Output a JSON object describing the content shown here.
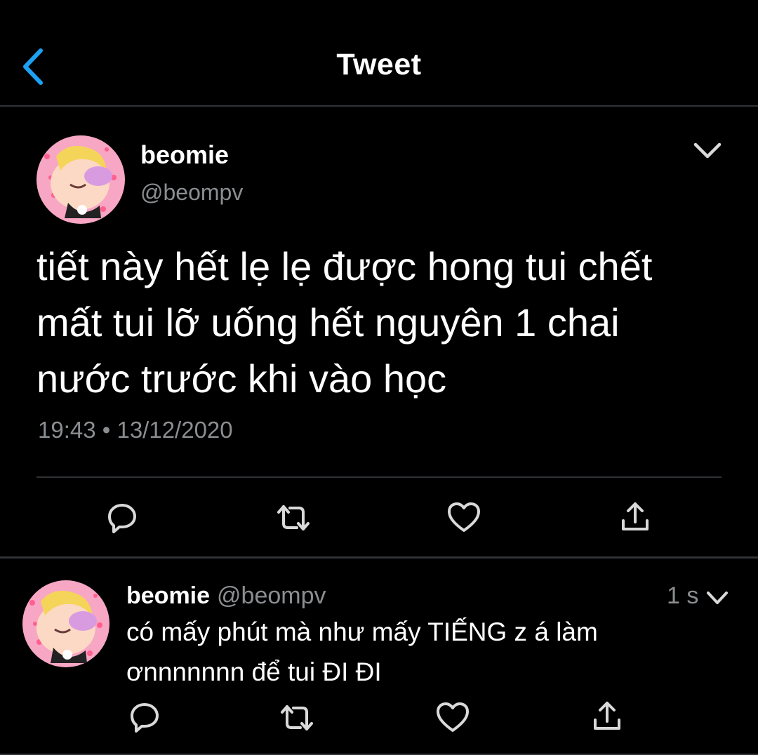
{
  "header": {
    "title": "Tweet",
    "back_icon": "chevron-left-icon",
    "accent": "#1da1f2"
  },
  "tweet": {
    "display_name": "beomie",
    "handle": "@beompv",
    "text_lines": [
      "tiết này hết lẹ lẹ được hong tui chết",
      "mất tui lỡ uống hết nguyên 1 chai",
      "nước trước khi vào học"
    ],
    "timestamp": "19:43 • 13/12/2020",
    "actions": [
      "reply-icon",
      "retweet-icon",
      "like-icon",
      "share-icon"
    ]
  },
  "reply": {
    "display_name": "beomie",
    "handle": "@beompv",
    "time": "1 s",
    "text_lines": [
      "có mấy phút mà như mấy TIẾNG z á làm",
      "ơnnnnnnn để tui ĐI ĐI"
    ],
    "actions": [
      "reply-icon",
      "retweet-icon",
      "like-icon",
      "share-icon"
    ]
  },
  "colors": {
    "background": "#000000",
    "text": "#ffffff",
    "muted": "#8b8e91",
    "divider": "#2f3336"
  }
}
